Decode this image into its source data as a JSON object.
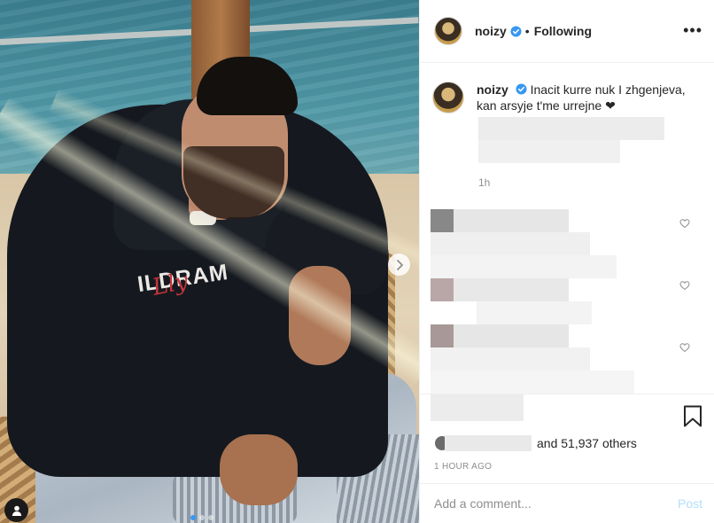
{
  "post": {
    "username": "noizy",
    "follow_status": "Following",
    "separator": "•",
    "more_label": "•••",
    "caption": "Inacit kurre nuk I zhgenjeva, kan arsyje t'me urrejne ❤",
    "caption_time": "1h",
    "likes_count": "51,937",
    "likes_suffix": "and 51,937 others",
    "time_ago": "1 HOUR AGO",
    "photo_print": "ILDRAM",
    "photo_script": "Lly"
  },
  "comment_box": {
    "placeholder": "Add a comment...",
    "post_label": "Post"
  },
  "icons": {
    "verified": "verified-badge-icon",
    "more": "more-options-icon",
    "heart": "heart-icon",
    "save": "bookmark-icon",
    "next": "chevron-right-icon",
    "tag": "user-tag-icon"
  },
  "colors": {
    "verified_blue": "#3897f0",
    "text": "#262626",
    "muted": "#8e8e8e",
    "post_disabled": "#b2dffc",
    "border": "#efefef"
  }
}
